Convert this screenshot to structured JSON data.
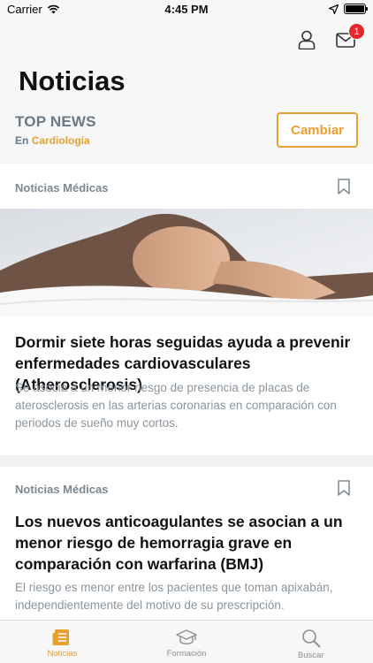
{
  "status_bar": {
    "carrier": "Carrier",
    "time": "4:45 PM"
  },
  "header": {
    "title": "Noticias",
    "notification_count": "1",
    "section_label": "TOP NEWS",
    "specialty_prefix": "En",
    "specialty": "Cardiología",
    "change_button": "Cambiar"
  },
  "articles": [
    {
      "category": "Noticias Médicas",
      "title": "Dormir siete horas seguidas ayuda a prevenir enfermedades cardiovasculares (Atherosclerosis)",
      "summary": "Se asocia a un menor riesgo de presencia de placas de aterosclerosis en las arterias coronarias en comparación con periodos de sueño muy cortos."
    },
    {
      "category": "Noticias Médicas",
      "title": "Los nuevos anticoagulantes se asocian a un menor riesgo de hemorragia grave en comparación con warfarina (BMJ)",
      "summary": "El riesgo es menor entre los pacientes que toman apixabán, independientemente del motivo de su prescripción."
    }
  ],
  "tabs": [
    {
      "label": "Noticias",
      "icon": "newspaper-icon",
      "active": true
    },
    {
      "label": "Formación",
      "icon": "graduation-cap-icon",
      "active": false
    },
    {
      "label": "Buscar",
      "icon": "search-icon",
      "active": false
    }
  ],
  "colors": {
    "accent": "#e8a030",
    "badge": "#e8252c",
    "muted_text": "#8a959e"
  }
}
